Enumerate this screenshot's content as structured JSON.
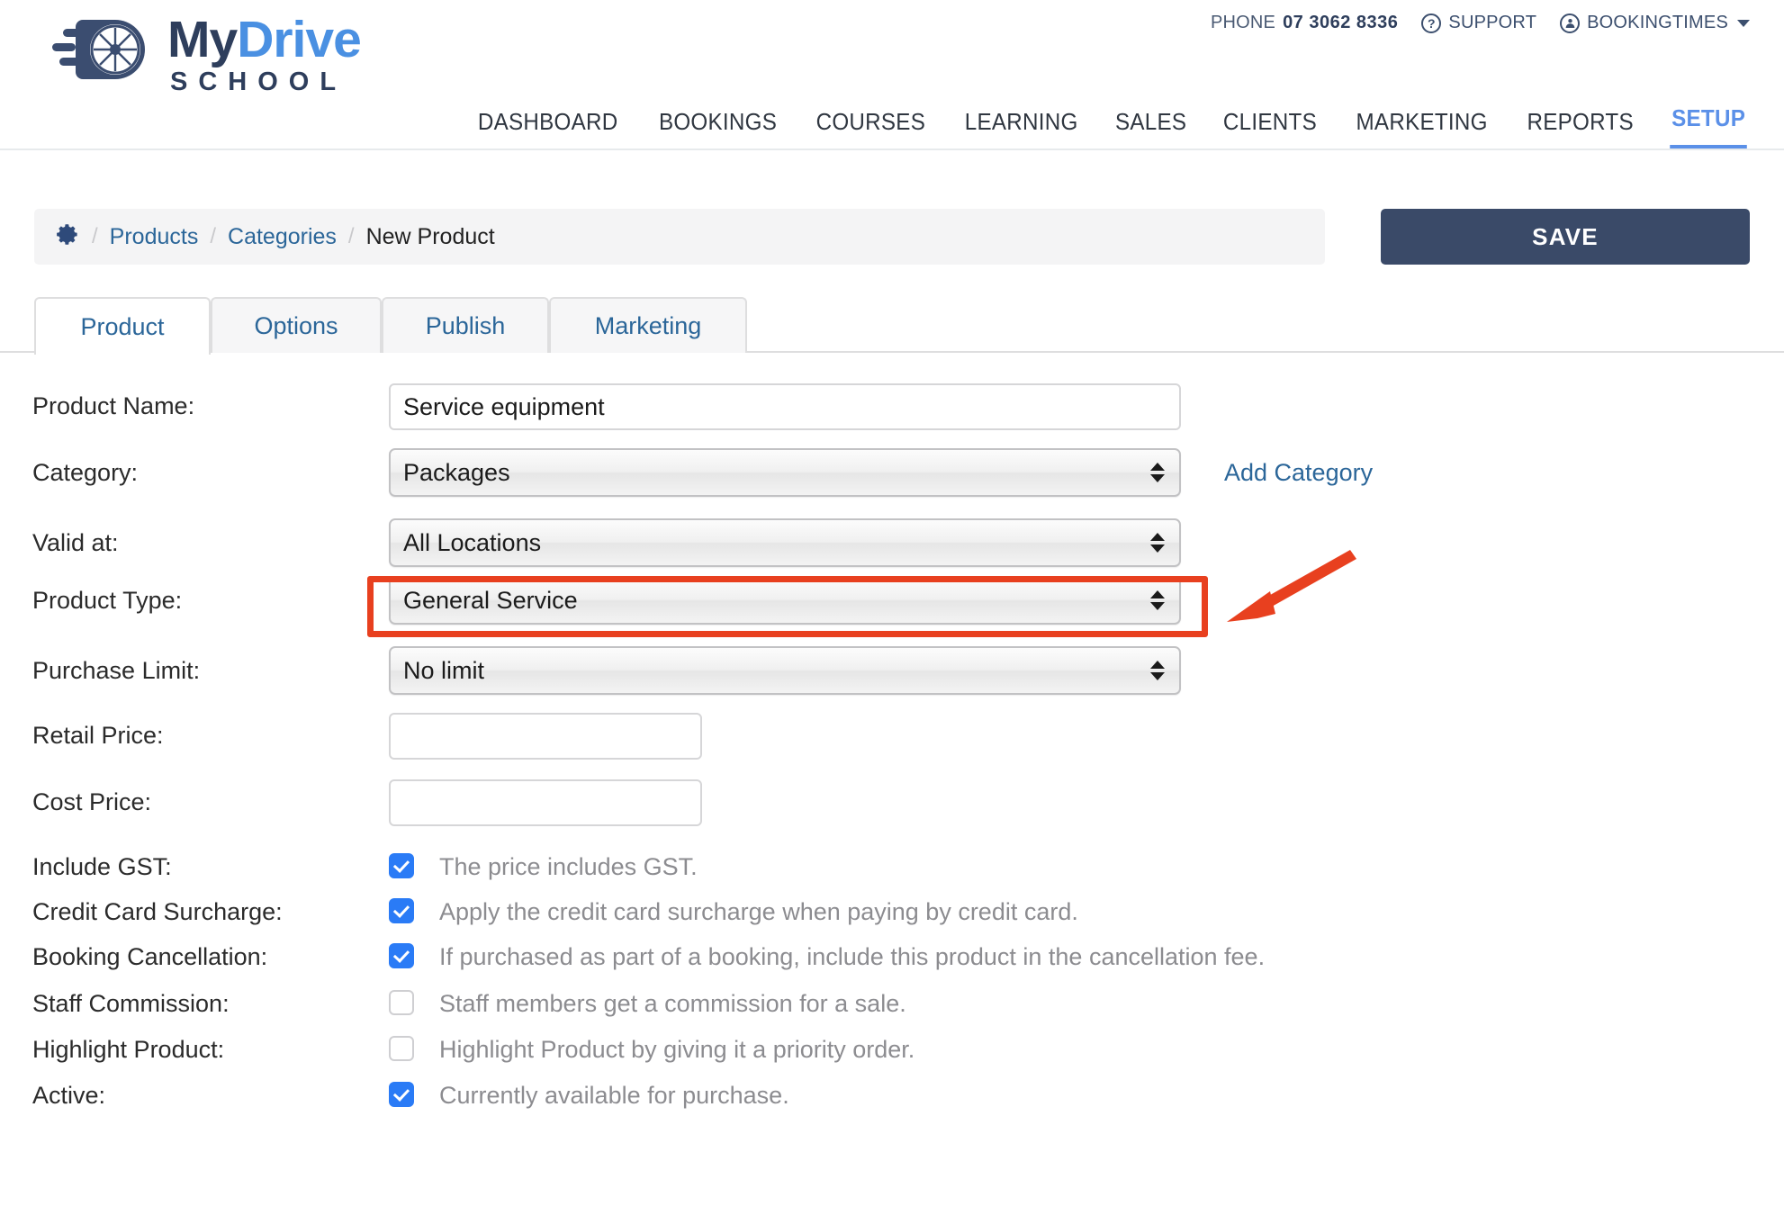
{
  "header": {
    "logo": {
      "icon": "wheel-speed-logo-icon",
      "line1_part1": "My",
      "line1_part2": "Drive",
      "line2": "SCHOOL"
    },
    "utility": {
      "phone_label": "PHONE",
      "phone_number": "07 3062 8336",
      "support_label": "SUPPORT",
      "support_icon": "question-circle-icon",
      "account_label": "BOOKINGTIMES",
      "account_icon": "user-circle-icon",
      "account_caret_icon": "caret-down-icon"
    },
    "nav": [
      {
        "label": "DASHBOARD",
        "active": false
      },
      {
        "label": "BOOKINGS",
        "active": false
      },
      {
        "label": "COURSES",
        "active": false
      },
      {
        "label": "LEARNING",
        "active": false
      },
      {
        "label": "SALES",
        "active": false
      },
      {
        "label": "CLIENTS",
        "active": false
      },
      {
        "label": "MARKETING",
        "active": false
      },
      {
        "label": "REPORTS",
        "active": false
      },
      {
        "label": "SETUP",
        "active": true
      }
    ]
  },
  "breadcrumb": {
    "gear_icon": "gear-icon",
    "sep": "/",
    "items": [
      {
        "label": "Products",
        "link": true
      },
      {
        "label": "Categories",
        "link": true
      },
      {
        "label": "New Product",
        "link": false
      }
    ]
  },
  "toolbar": {
    "save_label": "SAVE"
  },
  "tabs": [
    {
      "label": "Product",
      "active": true
    },
    {
      "label": "Options",
      "active": false
    },
    {
      "label": "Publish",
      "active": false
    },
    {
      "label": "Marketing",
      "active": false
    }
  ],
  "form": {
    "product_name": {
      "label": "Product Name:",
      "value": "Service equipment",
      "placeholder": ""
    },
    "category": {
      "label": "Category:",
      "value": "Packages",
      "add_link": "Add Category"
    },
    "valid_at": {
      "label": "Valid at:",
      "value": "All Locations"
    },
    "product_type": {
      "label": "Product Type:",
      "value": "General Service",
      "highlighted": true
    },
    "purchase_limit": {
      "label": "Purchase Limit:",
      "value": "No limit"
    },
    "retail_price": {
      "label": "Retail Price:",
      "value": "",
      "placeholder": ""
    },
    "cost_price": {
      "label": "Cost Price:",
      "value": "",
      "placeholder": ""
    },
    "checkboxes": [
      {
        "label": "Include GST:",
        "text": "The price includes GST.",
        "checked": true
      },
      {
        "label": "Credit Card Surcharge:",
        "text": "Apply the credit card surcharge when paying by credit card.",
        "checked": true
      },
      {
        "label": "Booking Cancellation:",
        "text": "If purchased as part of a booking, include this product in the cancellation fee.",
        "checked": true
      },
      {
        "label": "Staff Commission:",
        "text": "Staff members get a commission for a sale.",
        "checked": false
      },
      {
        "label": "Highlight Product:",
        "text": "Highlight Product by giving it a priority order.",
        "checked": false
      },
      {
        "label": "Active:",
        "text": "Currently available for purchase.",
        "checked": true
      }
    ]
  },
  "annotation": {
    "highlight_color": "#e8401f",
    "arrow_color": "#e8401f",
    "target": "product-type-select"
  },
  "colors": {
    "brand_dark": "#2e3e5c",
    "brand_blue": "#4a90e2",
    "link_blue": "#2b6699",
    "nav_active": "#5b90e8",
    "save_bg": "#3a4a68",
    "checkbox_blue": "#2a7bf6",
    "muted_text": "#8c8c90"
  }
}
